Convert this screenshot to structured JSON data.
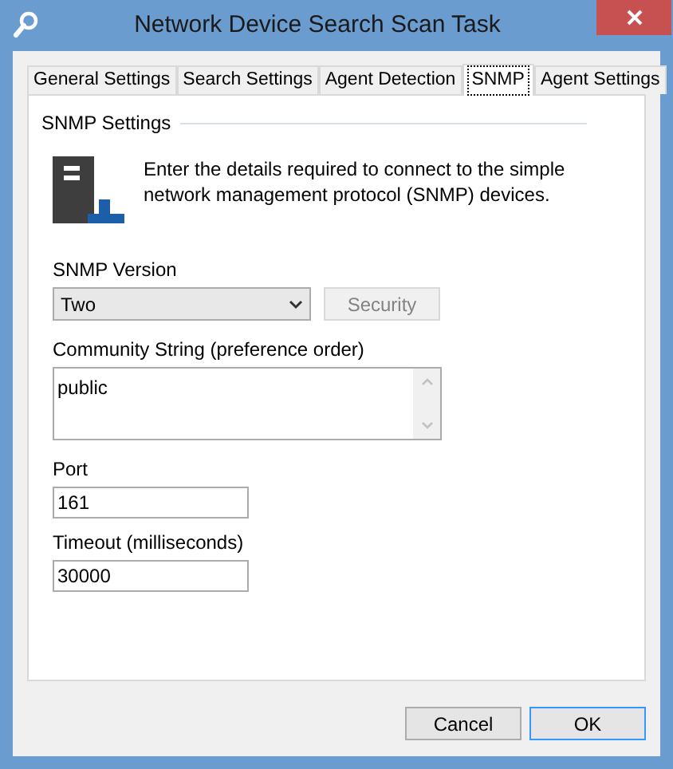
{
  "window": {
    "title": "Network Device Search Scan Task"
  },
  "tabs": [
    {
      "label": "General Settings",
      "selected": false
    },
    {
      "label": "Search Settings",
      "selected": false
    },
    {
      "label": "Agent Detection",
      "selected": false
    },
    {
      "label": "SNMP",
      "selected": true
    },
    {
      "label": "Agent Settings",
      "selected": false
    }
  ],
  "section": {
    "title": "SNMP Settings",
    "description": "Enter the details required to connect to the simple network management protocol (SNMP) devices."
  },
  "snmp_version": {
    "label": "SNMP Version",
    "value": "Two"
  },
  "security_button": {
    "label": "Security",
    "disabled": true
  },
  "community_string": {
    "label": "Community String (preference order)",
    "value": "public"
  },
  "port": {
    "label": "Port",
    "value": "161"
  },
  "timeout": {
    "label": "Timeout (milliseconds)",
    "value": "30000"
  },
  "buttons": [
    {
      "label": "Cancel",
      "default": false
    },
    {
      "label": "OK",
      "default": true
    }
  ]
}
